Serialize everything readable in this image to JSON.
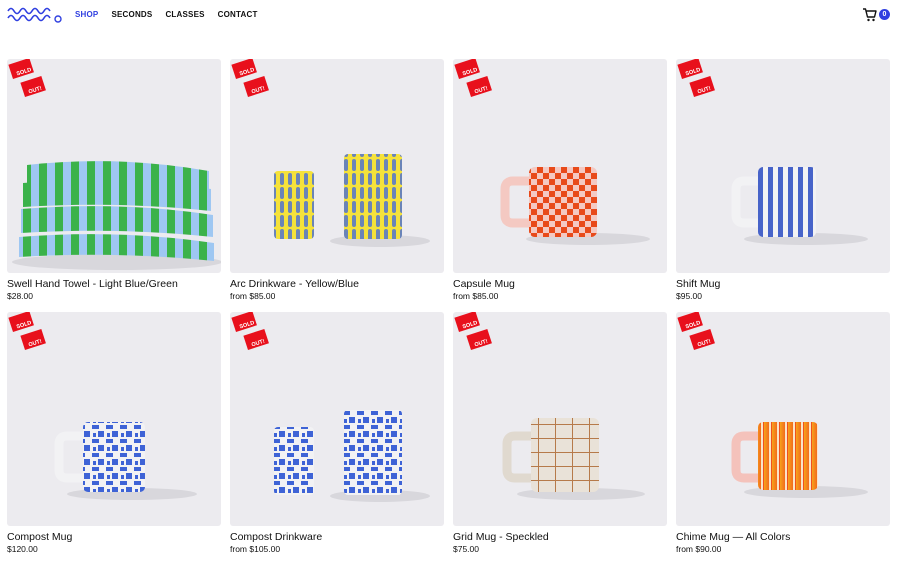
{
  "brand": {
    "logo_icon": "wavy-brand-logo-icon",
    "accent": "#2f3fe0"
  },
  "nav": {
    "items": [
      {
        "label": "SHOP",
        "active": true
      },
      {
        "label": "SECONDS",
        "active": false
      },
      {
        "label": "CLASSES",
        "active": false
      },
      {
        "label": "CONTACT",
        "active": false
      }
    ]
  },
  "cart": {
    "icon": "cart-icon",
    "count": "0"
  },
  "sold_out": {
    "line1": "SOLD",
    "line2": "OUT!",
    "color": "#e8101c"
  },
  "products": [
    {
      "name": "Swell Hand Towel - Light Blue/Green",
      "price": "$28.00"
    },
    {
      "name": "Arc Drinkware - Yellow/Blue",
      "price": "from $85.00"
    },
    {
      "name": "Capsule Mug",
      "price": "from $85.00"
    },
    {
      "name": "Shift Mug",
      "price": "$95.00"
    },
    {
      "name": "Compost Mug",
      "price": "$120.00"
    },
    {
      "name": "Compost Drinkware",
      "price": "from $105.00"
    },
    {
      "name": "Grid Mug - Speckled",
      "price": "$75.00"
    },
    {
      "name": "Chime Mug — All Colors",
      "price": "from $90.00"
    }
  ]
}
